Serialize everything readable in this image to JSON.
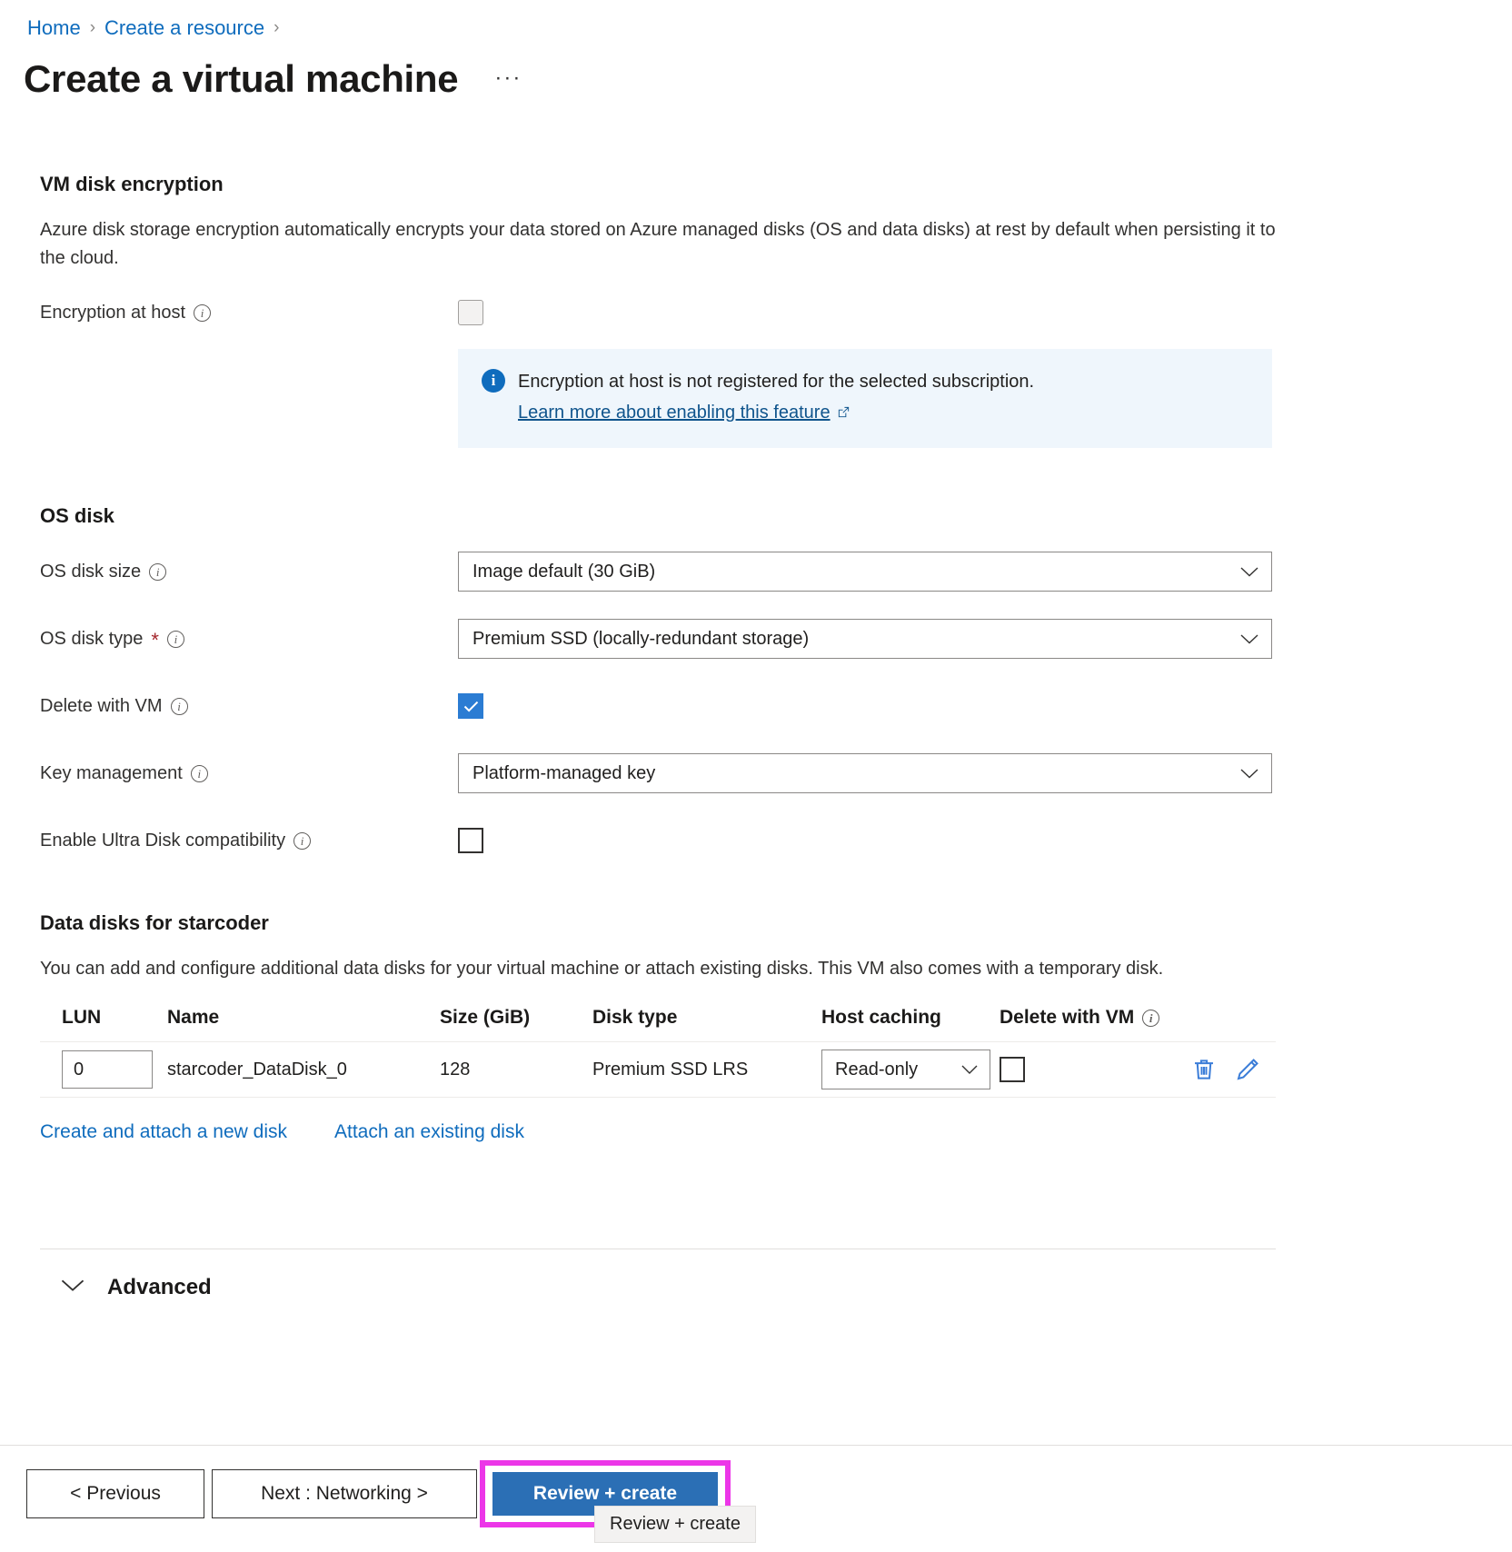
{
  "breadcrumb": {
    "items": [
      "Home",
      "Create a resource"
    ],
    "separator": "›"
  },
  "header": {
    "title": "Create a virtual machine",
    "more_actions": "···"
  },
  "encryption_section": {
    "heading": "VM disk encryption",
    "description": "Azure disk storage encryption automatically encrypts your data stored on Azure managed disks (OS and data disks) at rest by default when persisting it to the cloud.",
    "encryption_at_host": {
      "label": "Encryption at host",
      "checked": false,
      "disabled": true
    },
    "banner": {
      "text": "Encryption at host is not registered for the selected subscription.",
      "link": "Learn more about enabling this feature",
      "icon": "info-icon"
    }
  },
  "os_disk_section": {
    "heading": "OS disk",
    "fields": [
      {
        "label": "OS disk size",
        "value": "Image default (30 GiB)",
        "required": false
      },
      {
        "label": "OS disk type",
        "value": "Premium SSD (locally-redundant storage)",
        "required": true
      },
      {
        "label": "Key management",
        "value": "Platform-managed key",
        "required": false
      }
    ],
    "delete_with_vm": {
      "label": "Delete with VM",
      "checked": true
    },
    "ultra_disk": {
      "label": "Enable Ultra Disk compatibility",
      "checked": false
    }
  },
  "data_disks_section": {
    "heading": "Data disks for starcoder",
    "description": "You can add and configure additional data disks for your virtual machine or attach existing disks. This VM also comes with a temporary disk.",
    "columns": [
      "LUN",
      "Name",
      "Size (GiB)",
      "Disk type",
      "Host caching",
      "Delete with VM"
    ],
    "rows": [
      {
        "lun": "0",
        "name": "starcoder_DataDisk_0",
        "size": "128",
        "disk_type": "Premium SSD LRS",
        "host_caching": "Read-only",
        "delete_with_vm": false
      }
    ],
    "links": [
      "Create and attach a new disk",
      "Attach an existing disk"
    ]
  },
  "advanced_section": {
    "label": "Advanced",
    "expanded": false
  },
  "footer": {
    "previous": "< Previous",
    "next": "Next : Networking >",
    "review": "Review + create",
    "tooltip": "Review + create"
  },
  "colors": {
    "link": "#0f6cbd",
    "primary_button": "#2b6fb5",
    "checkbox_checked": "#2b7cd3",
    "highlight": "#ec36e8",
    "banner_bg": "#eff6fc",
    "required_star": "#a4262c",
    "action_icon": "#3b7dd8"
  }
}
